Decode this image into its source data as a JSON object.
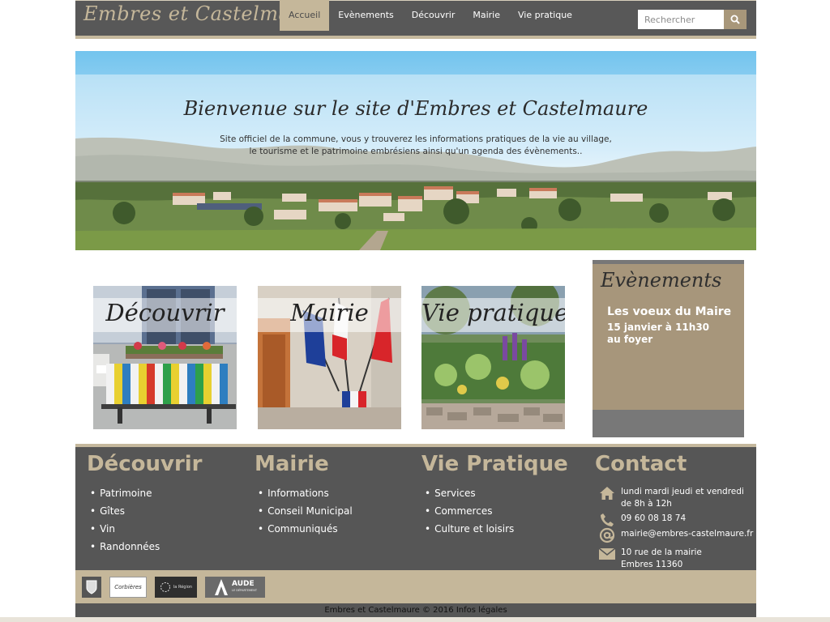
{
  "brand": "Embres et Castelmaure",
  "nav": [
    {
      "label": "Accueil",
      "active": true
    },
    {
      "label": "Evènements"
    },
    {
      "label": "Découvrir"
    },
    {
      "label": "Mairie"
    },
    {
      "label": "Vie pratique"
    }
  ],
  "search": {
    "placeholder": "Rechercher",
    "icon": "search-icon"
  },
  "hero": {
    "title": "Bienvenue sur le site d'Embres et Castelmaure",
    "subtitle_line1": "Site officiel de la commune, vous y trouverez les informations pratiques de la vie au village,",
    "subtitle_line2": "le tourisme et le patrimoine embrésiens ainsi qu'un agenda des évènements.."
  },
  "tiles": [
    {
      "label": "Découvrir"
    },
    {
      "label": "Mairie"
    },
    {
      "label": "Vie pratique"
    }
  ],
  "events": {
    "title": "Evènements",
    "item_name": "Les voeux du Maire",
    "item_date": "15 janvier à 11h30",
    "item_place": "au foyer"
  },
  "footer": {
    "decouvrir": {
      "title": "Découvrir",
      "items": [
        "Patrimoine",
        "Gîtes",
        "Vin",
        "Randonnées"
      ]
    },
    "mairie": {
      "title": "Mairie",
      "items": [
        "Informations",
        "Conseil Municipal",
        "Communiqués"
      ]
    },
    "vie": {
      "title": "Vie Pratique",
      "items": [
        "Services",
        "Commerces",
        "Culture et loisirs"
      ]
    },
    "contact": {
      "title": "Contact",
      "hours_line1": "lundi mardi jeudi et vendredi",
      "hours_line2": "de 8h à 12h",
      "phone": "09 60 08 18 74",
      "email": "mairie@embres-castelmaure.fr",
      "address_line1": "10 rue de la mairie",
      "address_line2": "Embres 11360"
    }
  },
  "logos": {
    "corbieres": "Corbières",
    "region": "la Région",
    "aude": "AUDE",
    "aude_sub": "LE DÉPARTEMENT"
  },
  "copyright": "Embres et Castelmaure © 2016 Infos légales",
  "colors": {
    "accent": "#c5b79a",
    "dark": "#585858",
    "events_bg": "#a7967b"
  }
}
